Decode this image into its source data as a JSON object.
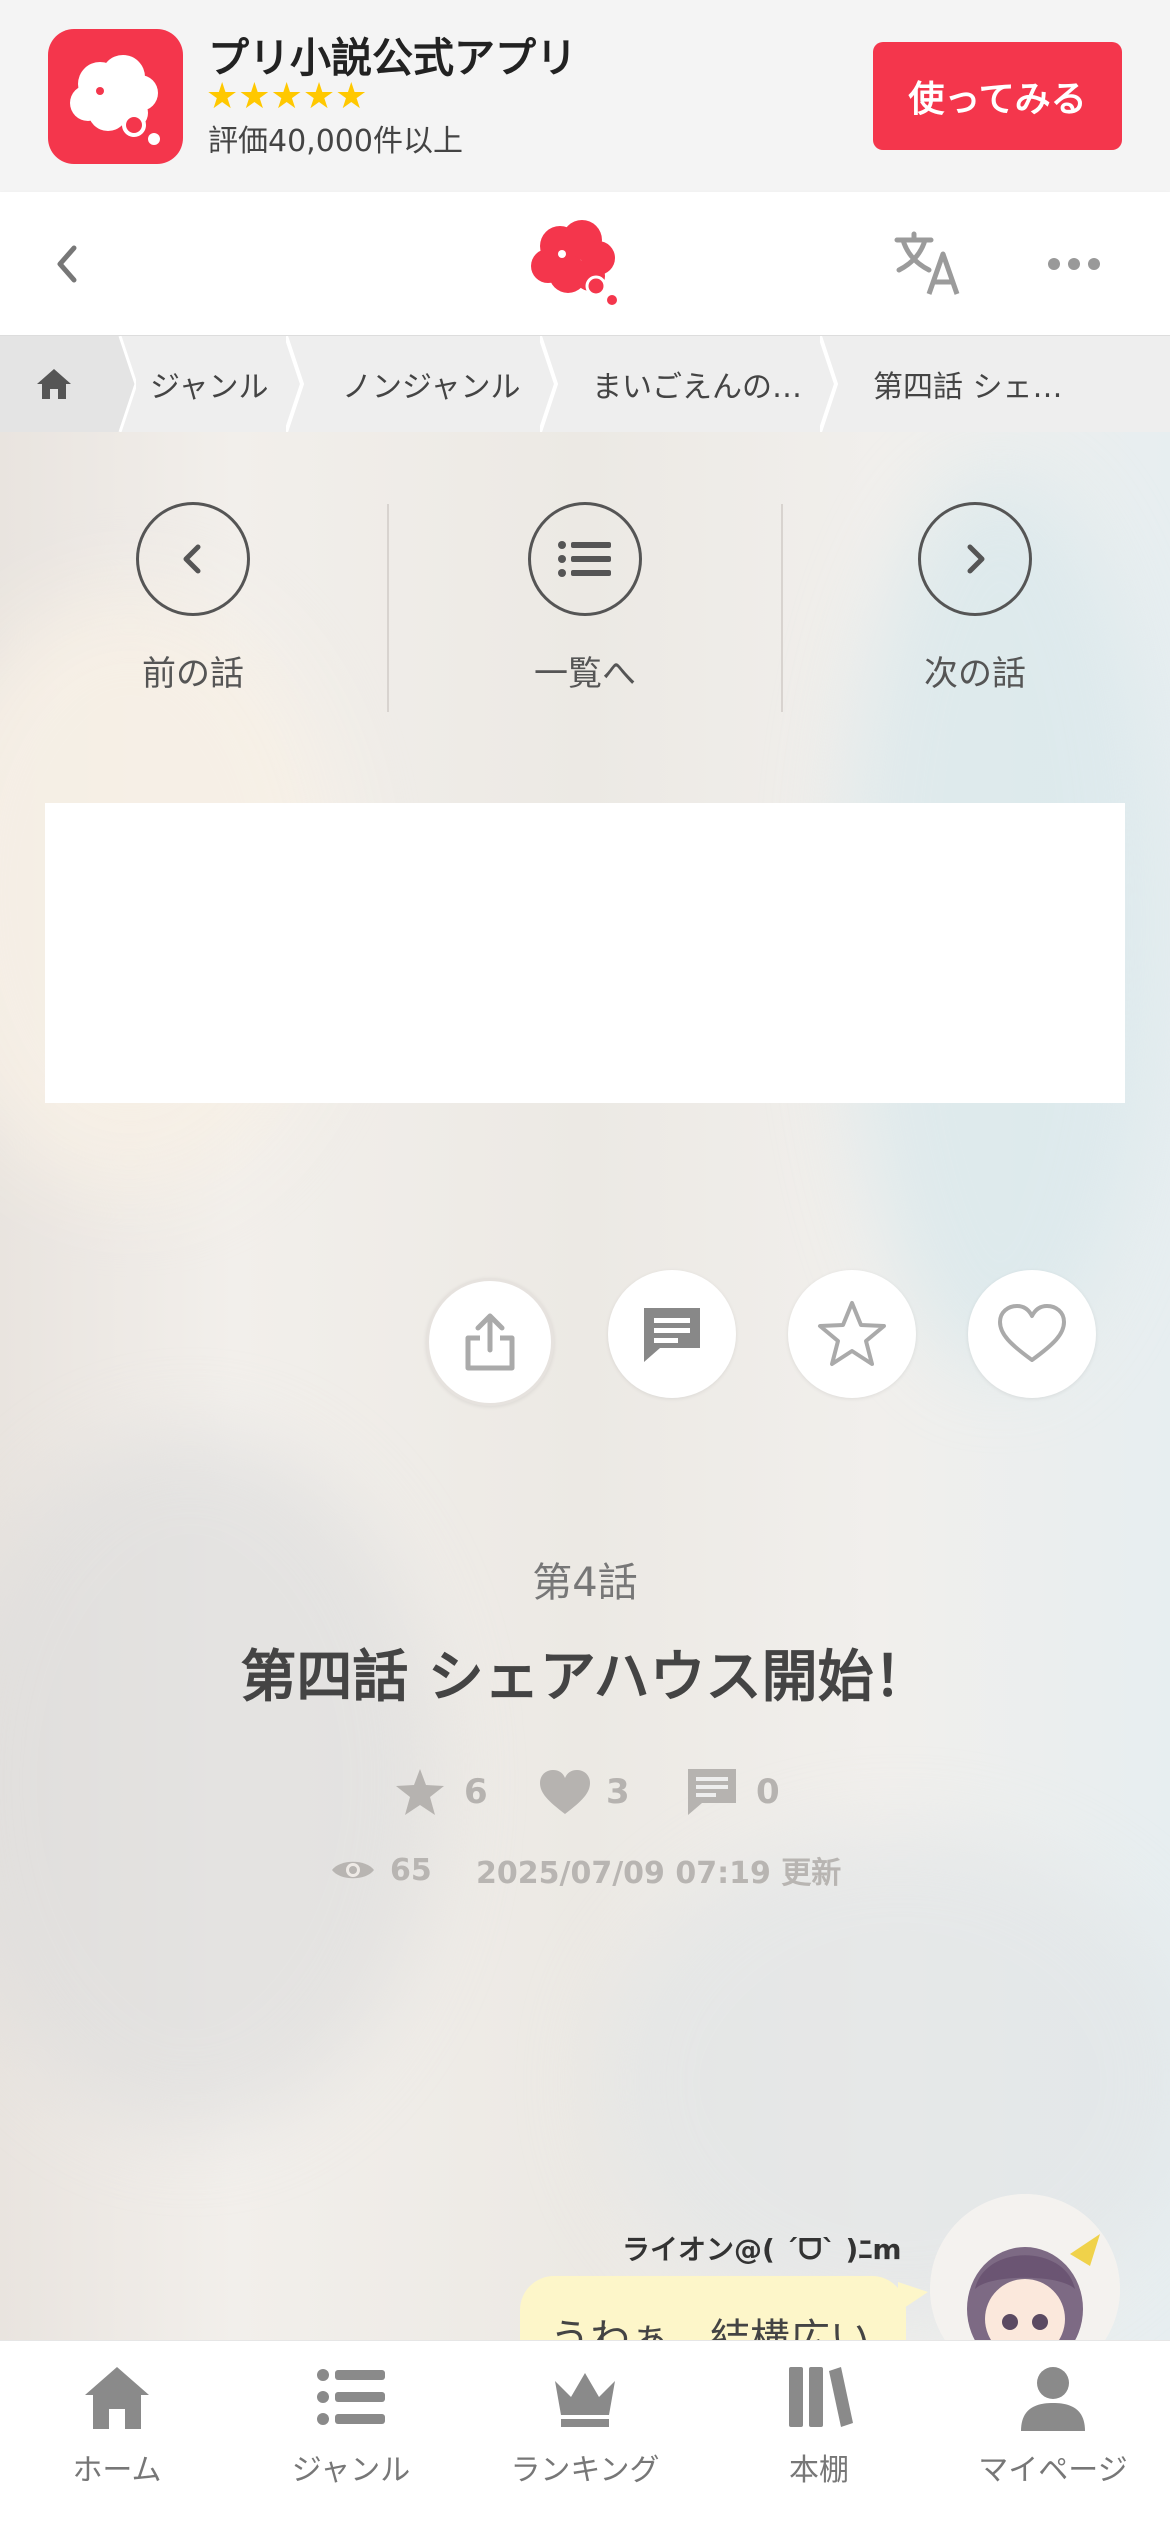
{
  "app_banner": {
    "title": "プリ小説公式アプリ",
    "stars": "★★★★★",
    "rating": "評価40,000件以上",
    "cta": "使ってみる"
  },
  "breadcrumb": [
    "ジャンル",
    "ノンジャンル",
    "まいごえんの…",
    "第四話 シェ…"
  ],
  "episode_nav": {
    "prev": "前の話",
    "list": "一覧へ",
    "next": "次の話"
  },
  "episode": {
    "number": "第4話",
    "title": "第四話 シェアハウス開始！",
    "stars": "6",
    "likes": "3",
    "comments": "0",
    "views": "65",
    "updated": "2025/07/09 07:19 更新"
  },
  "chat": {
    "name": "ライオン@( ´ᗜ` )ﾆm",
    "message": "うわぁ…結構広い"
  },
  "bottom_nav": [
    "ホーム",
    "ジャンル",
    "ランキング",
    "本棚",
    "マイページ"
  ],
  "colors": {
    "brand": "#f4364c",
    "star_yellow": "#ffc800",
    "bubble": "#fdf6c9"
  }
}
